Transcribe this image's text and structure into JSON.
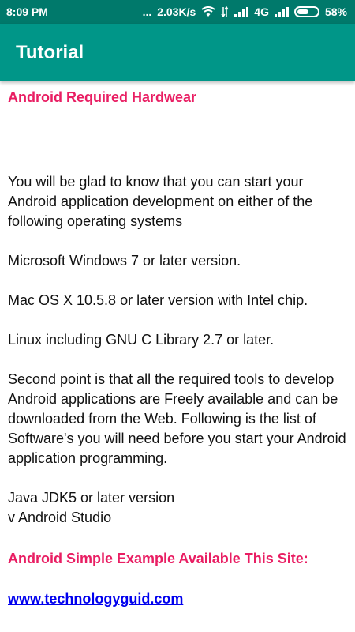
{
  "status_bar": {
    "time": "8:09 PM",
    "dots": "...",
    "network_speed": "2.03K/s",
    "network_type": "4G",
    "battery_percent": "58%",
    "battery_level": 0.58
  },
  "app_bar": {
    "title": "Tutorial",
    "color": "#009688"
  },
  "content": {
    "heading1": "Android Required Hardwear",
    "intro": "You will be glad to know that you can start your Android application development on either of the following operating systems",
    "os1": "Microsoft Windows 7 or later version.",
    "os2": "Mac OS X 10.5.8 or later version with Intel chip.",
    "os3": "Linux including GNU C Library 2.7 or later.",
    "second_point": "Second point is that all the required tools to develop Android applications are Freely available and can be downloaded from the Web. Following is the list of Software's you will need before you start your Android application programming.",
    "software1": "Java JDK5 or later version",
    "software2": "v Android Studio",
    "heading2": "Android Simple Example Available This Site:",
    "link": "www.technologyguid.com",
    "accent_color": "#e91e63",
    "link_color": "#0000ee"
  }
}
